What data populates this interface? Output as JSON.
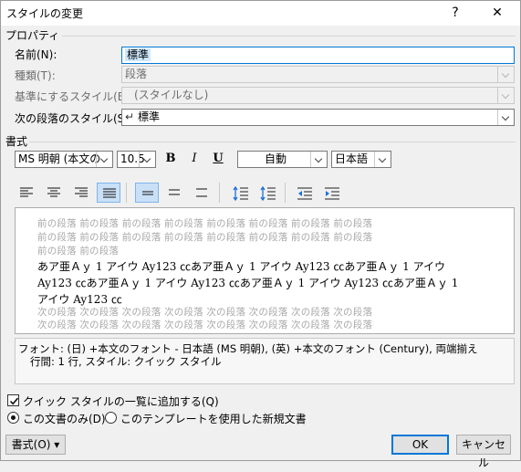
{
  "window": {
    "title": "スタイルの変更",
    "help_glyph": "?",
    "close_glyph": "✕"
  },
  "properties": {
    "group_label": "プロパティ",
    "name_label": "名前(N):",
    "name_value": "標準",
    "type_label": "種類(T):",
    "type_value": "段落",
    "based_on_label": "基準にするスタイル(B):",
    "based_on_value": "(スタイルなし)",
    "next_style_label": "次の段落のスタイル(S):",
    "next_style_value": "標準"
  },
  "format": {
    "group_label": "書式",
    "font_value": "MS 明朝 (本文の",
    "size_value": "10.5",
    "bold_label": "B",
    "italic_label": "I",
    "underline_label": "U",
    "color_value": "自動",
    "language_value": "日本語"
  },
  "toolbar2": {
    "icons": [
      "align-left-icon",
      "align-center-icon",
      "align-right-icon",
      "justify-icon",
      "distributed-icon",
      "single-spacing-icon",
      "onehalf-spacing-icon",
      "double-spacing-icon",
      "space-before-icon",
      "space-after-icon",
      "decrease-indent-icon",
      "increase-indent-icon"
    ]
  },
  "preview": {
    "prev_lines": [
      "前の段落 前の段落 前の段落 前の段落 前の段落 前の段落 前の段落 前の段落",
      "前の段落 前の段落 前の段落 前の段落 前の段落 前の段落 前の段落 前の段落",
      "前の段落 前の段落"
    ],
    "sample_lines": [
      "あア亜Ａｙ 1 アイウ Ay123 ㏄あア亜Ａｙ 1 アイウ Ay123 ㏄あア亜Ａｙ 1 アイウ",
      "Ay123 ㏄あア亜Ａｙ 1 アイウ Ay123 ㏄あア亜Ａｙ 1 アイウ Ay123 ㏄あア亜Ａｙ 1",
      "アイウ Ay123 ㏄"
    ],
    "next_lines": [
      "次の段落 次の段落 次の段落 次の段落 次の段落 次の段落 次の段落 次の段落",
      "次の段落 次の段落 次の段落 次の段落 次の段落 次の段落 次の段落 次の段落"
    ]
  },
  "description": {
    "line1": "フォント: (日) +本文のフォント - 日本語 (MS 明朝), (英) +本文のフォント (Century), 両端揃え",
    "line2": "行間:  1 行, スタイル: クイック スタイル"
  },
  "options": {
    "quick_style_label": "クイック スタイルの一覧に追加する(Q)",
    "quick_style_checked": true,
    "only_this_doc_label": "この文書のみ(D)",
    "template_label": "このテンプレートを使用した新規文書",
    "selected": "only_this_doc"
  },
  "buttons": {
    "format": "書式(O) ▾",
    "ok": "OK",
    "cancel": "キャンセル"
  },
  "colors": {
    "focus": "#0078d7",
    "toggle_on": "#c9e0f7",
    "preview_gray": "#a8a8a8"
  }
}
